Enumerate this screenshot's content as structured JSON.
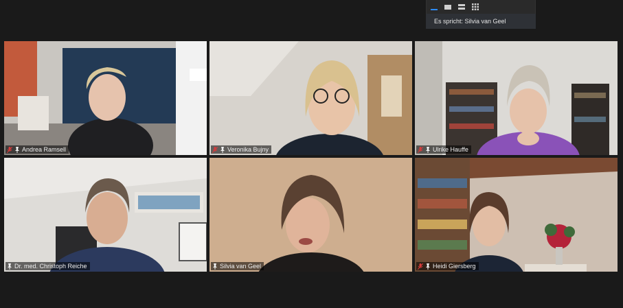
{
  "speaker_banner": "Es spricht: Silvia van Geel",
  "view_buttons": [
    "speaker-view-icon",
    "gallery-view-icon",
    "strip-view-icon",
    "grid-view-icon"
  ],
  "participants": [
    {
      "name": "Andrea Ramsell",
      "muted": true
    },
    {
      "name": "Veronika Bujny",
      "muted": true
    },
    {
      "name": "Ulrike Hauffe",
      "muted": true
    },
    {
      "name": "Dr. med. Christoph Reiche",
      "muted": false
    },
    {
      "name": "Silvia van Geel",
      "muted": false,
      "active_speaker": true
    },
    {
      "name": "Heidi Giersberg",
      "muted": true
    }
  ],
  "colors": {
    "active_border": "#e3de5c",
    "muted_red": "#d93b3b",
    "toolbar_accent": "#2d8cff"
  }
}
